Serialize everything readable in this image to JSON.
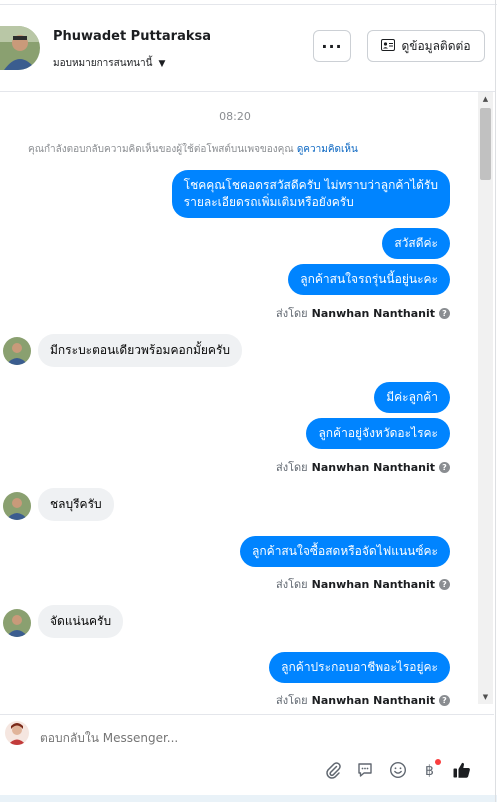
{
  "header": {
    "customer_name": "Phuwadet Puttaraksa",
    "assign_label": "มอบหมายการสนทนานี้",
    "more_label": "···",
    "contact_button_label": "ดูข้อมูลติดต่อ"
  },
  "chat": {
    "timestamp": "08:20",
    "notice_text": "คุณกำลังตอบกลับความคิดเห็นของผู้ใช้ต่อโพสต์บนเพจของคุณ",
    "notice_link": "ดูความคิดเห็น",
    "sent_prefix": "ส่งโดย",
    "sender_name": "Nanwhan Nanthanit",
    "messages": {
      "m1_line1": "โชคคุณโชคอดรสวัสดีครับ ไม่ทราบว่าลูกค้าได้รับ",
      "m1_line2": "รายละเอียดรถเพิ่มเติมหรือยังครับ",
      "m2": "สวัสดีค่ะ",
      "m3": "ลูกค้าสนใจรถรุ่นนี้อยู่นะคะ",
      "m4": "มีกระบะตอนเดียวพร้อมคอกมั้ยครับ",
      "m5": "มีค่ะลูกค้า",
      "m6": "ลูกค้าอยู่จังหวัดอะไรคะ",
      "m7": "ชลบุรีครับ",
      "m8": "ลูกค้าสนใจซื้อสดหรือจัดไฟแนนซ์คะ",
      "m9": "จัดแน่นครับ",
      "m10": "ลูกค้าประกอบอาชีพอะไรอยู่คะ"
    }
  },
  "composer": {
    "placeholder": "ตอบกลับใน Messenger..."
  },
  "icons": {
    "attach": "paperclip-icon",
    "saved_replies": "chat-bubble-icon",
    "emoji": "smiley-icon",
    "payment": "baht-icon",
    "like": "thumbs-up-icon"
  },
  "colors": {
    "outgoing_bubble": "#0084ff",
    "incoming_bubble": "#eff1f3",
    "link": "#0a66c2"
  }
}
